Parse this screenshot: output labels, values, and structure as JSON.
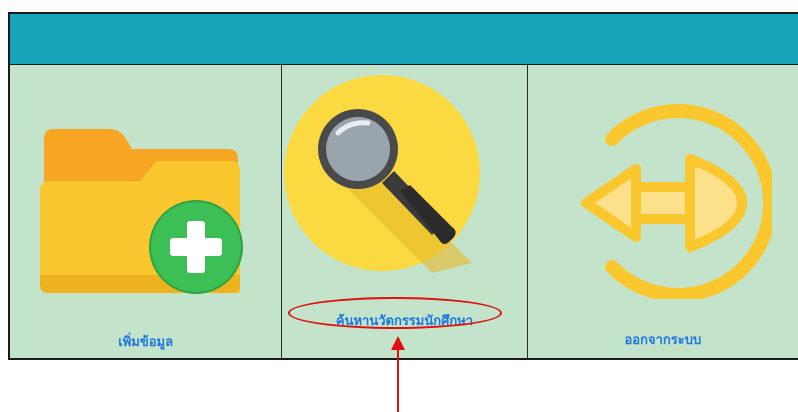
{
  "menu": {
    "items": [
      {
        "label": "เพิ่มข้อมูล",
        "icon": "folder-add-icon"
      },
      {
        "label": "ค้นหานวัตกรรมนักศึกษา",
        "icon": "magnifier-icon"
      },
      {
        "label": "ออกจากระบบ",
        "icon": "logout-icon"
      }
    ]
  },
  "colors": {
    "header": "#18a3b8",
    "tile_background": "#c4e3cb",
    "label": "#1f78e0",
    "annotation": "#e01010"
  }
}
